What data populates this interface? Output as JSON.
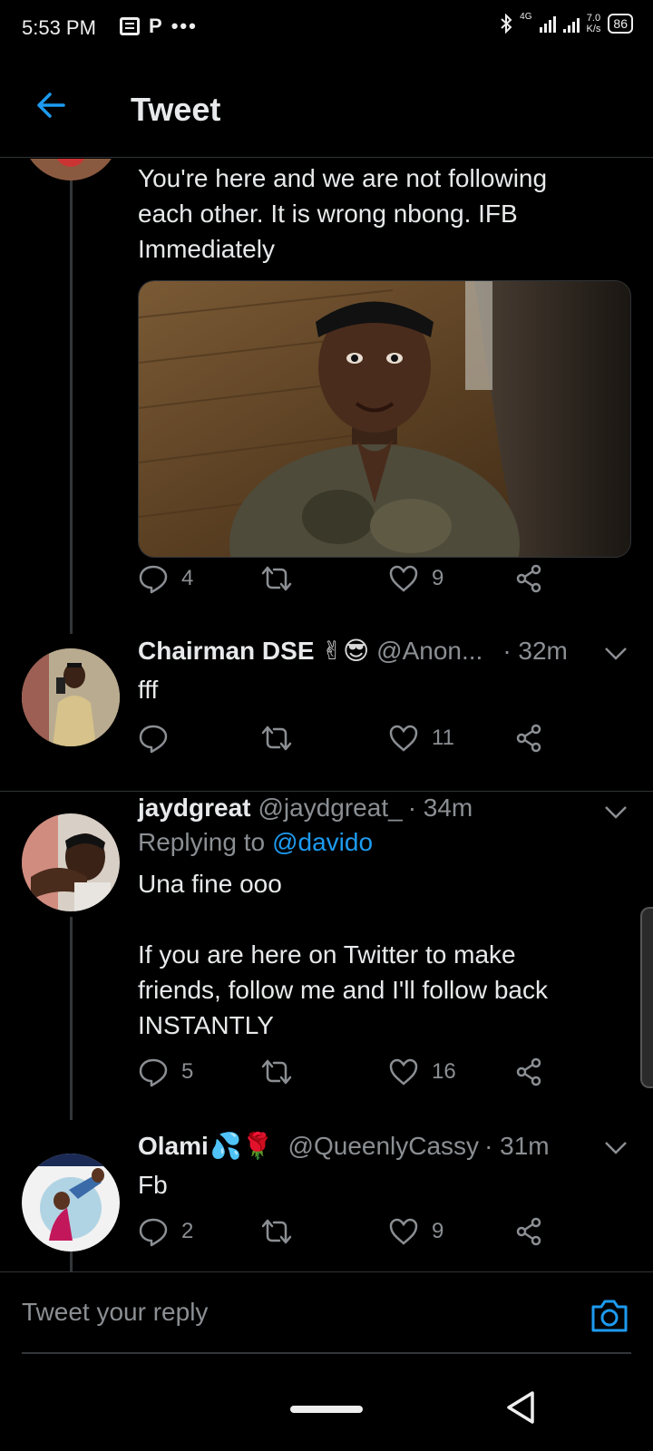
{
  "status_bar": {
    "time": "5:53 PM",
    "network": "4G",
    "speed_value": "7.0",
    "speed_unit": "K/s",
    "battery": "86"
  },
  "header": {
    "title": "Tweet",
    "back_icon": "arrow-left-icon"
  },
  "tweets": [
    {
      "text_lines": [
        "You're here and we are not following",
        "each other. It is wrong nbong. IFB",
        "Immediately"
      ],
      "has_image": true,
      "actions": {
        "replies": "4",
        "retweets": "",
        "likes": "9"
      }
    },
    {
      "name": "Chairman DSE",
      "emoji": "✌😎",
      "handle": "@Anon...",
      "time": "· 32m",
      "text": "fff",
      "actions": {
        "replies": "",
        "retweets": "",
        "likes": "11"
      }
    },
    {
      "name": "jaydgreat",
      "handle": "@jaydgreat_",
      "time": "· 34m",
      "replying_prefix": "Replying to",
      "replying_to": "@davido",
      "text_lines": [
        "Una fine ooo",
        "",
        "If you are here on Twitter to make",
        "friends, follow me and I'll follow back",
        "INSTANTLY"
      ],
      "actions": {
        "replies": "5",
        "retweets": "",
        "likes": "16"
      }
    },
    {
      "name": "Olami",
      "emoji": "💦🌹",
      "handle": "@QueenlyCassy",
      "time": "· 31m",
      "text": "Fb",
      "actions": {
        "replies": "2",
        "retweets": "",
        "likes": "9"
      }
    }
  ],
  "reply_bar": {
    "placeholder": "Tweet your reply",
    "camera_icon": "camera-icon"
  },
  "colors": {
    "background": "#000000",
    "accent": "#1d9bf0",
    "secondary_text": "#8b8f93"
  }
}
